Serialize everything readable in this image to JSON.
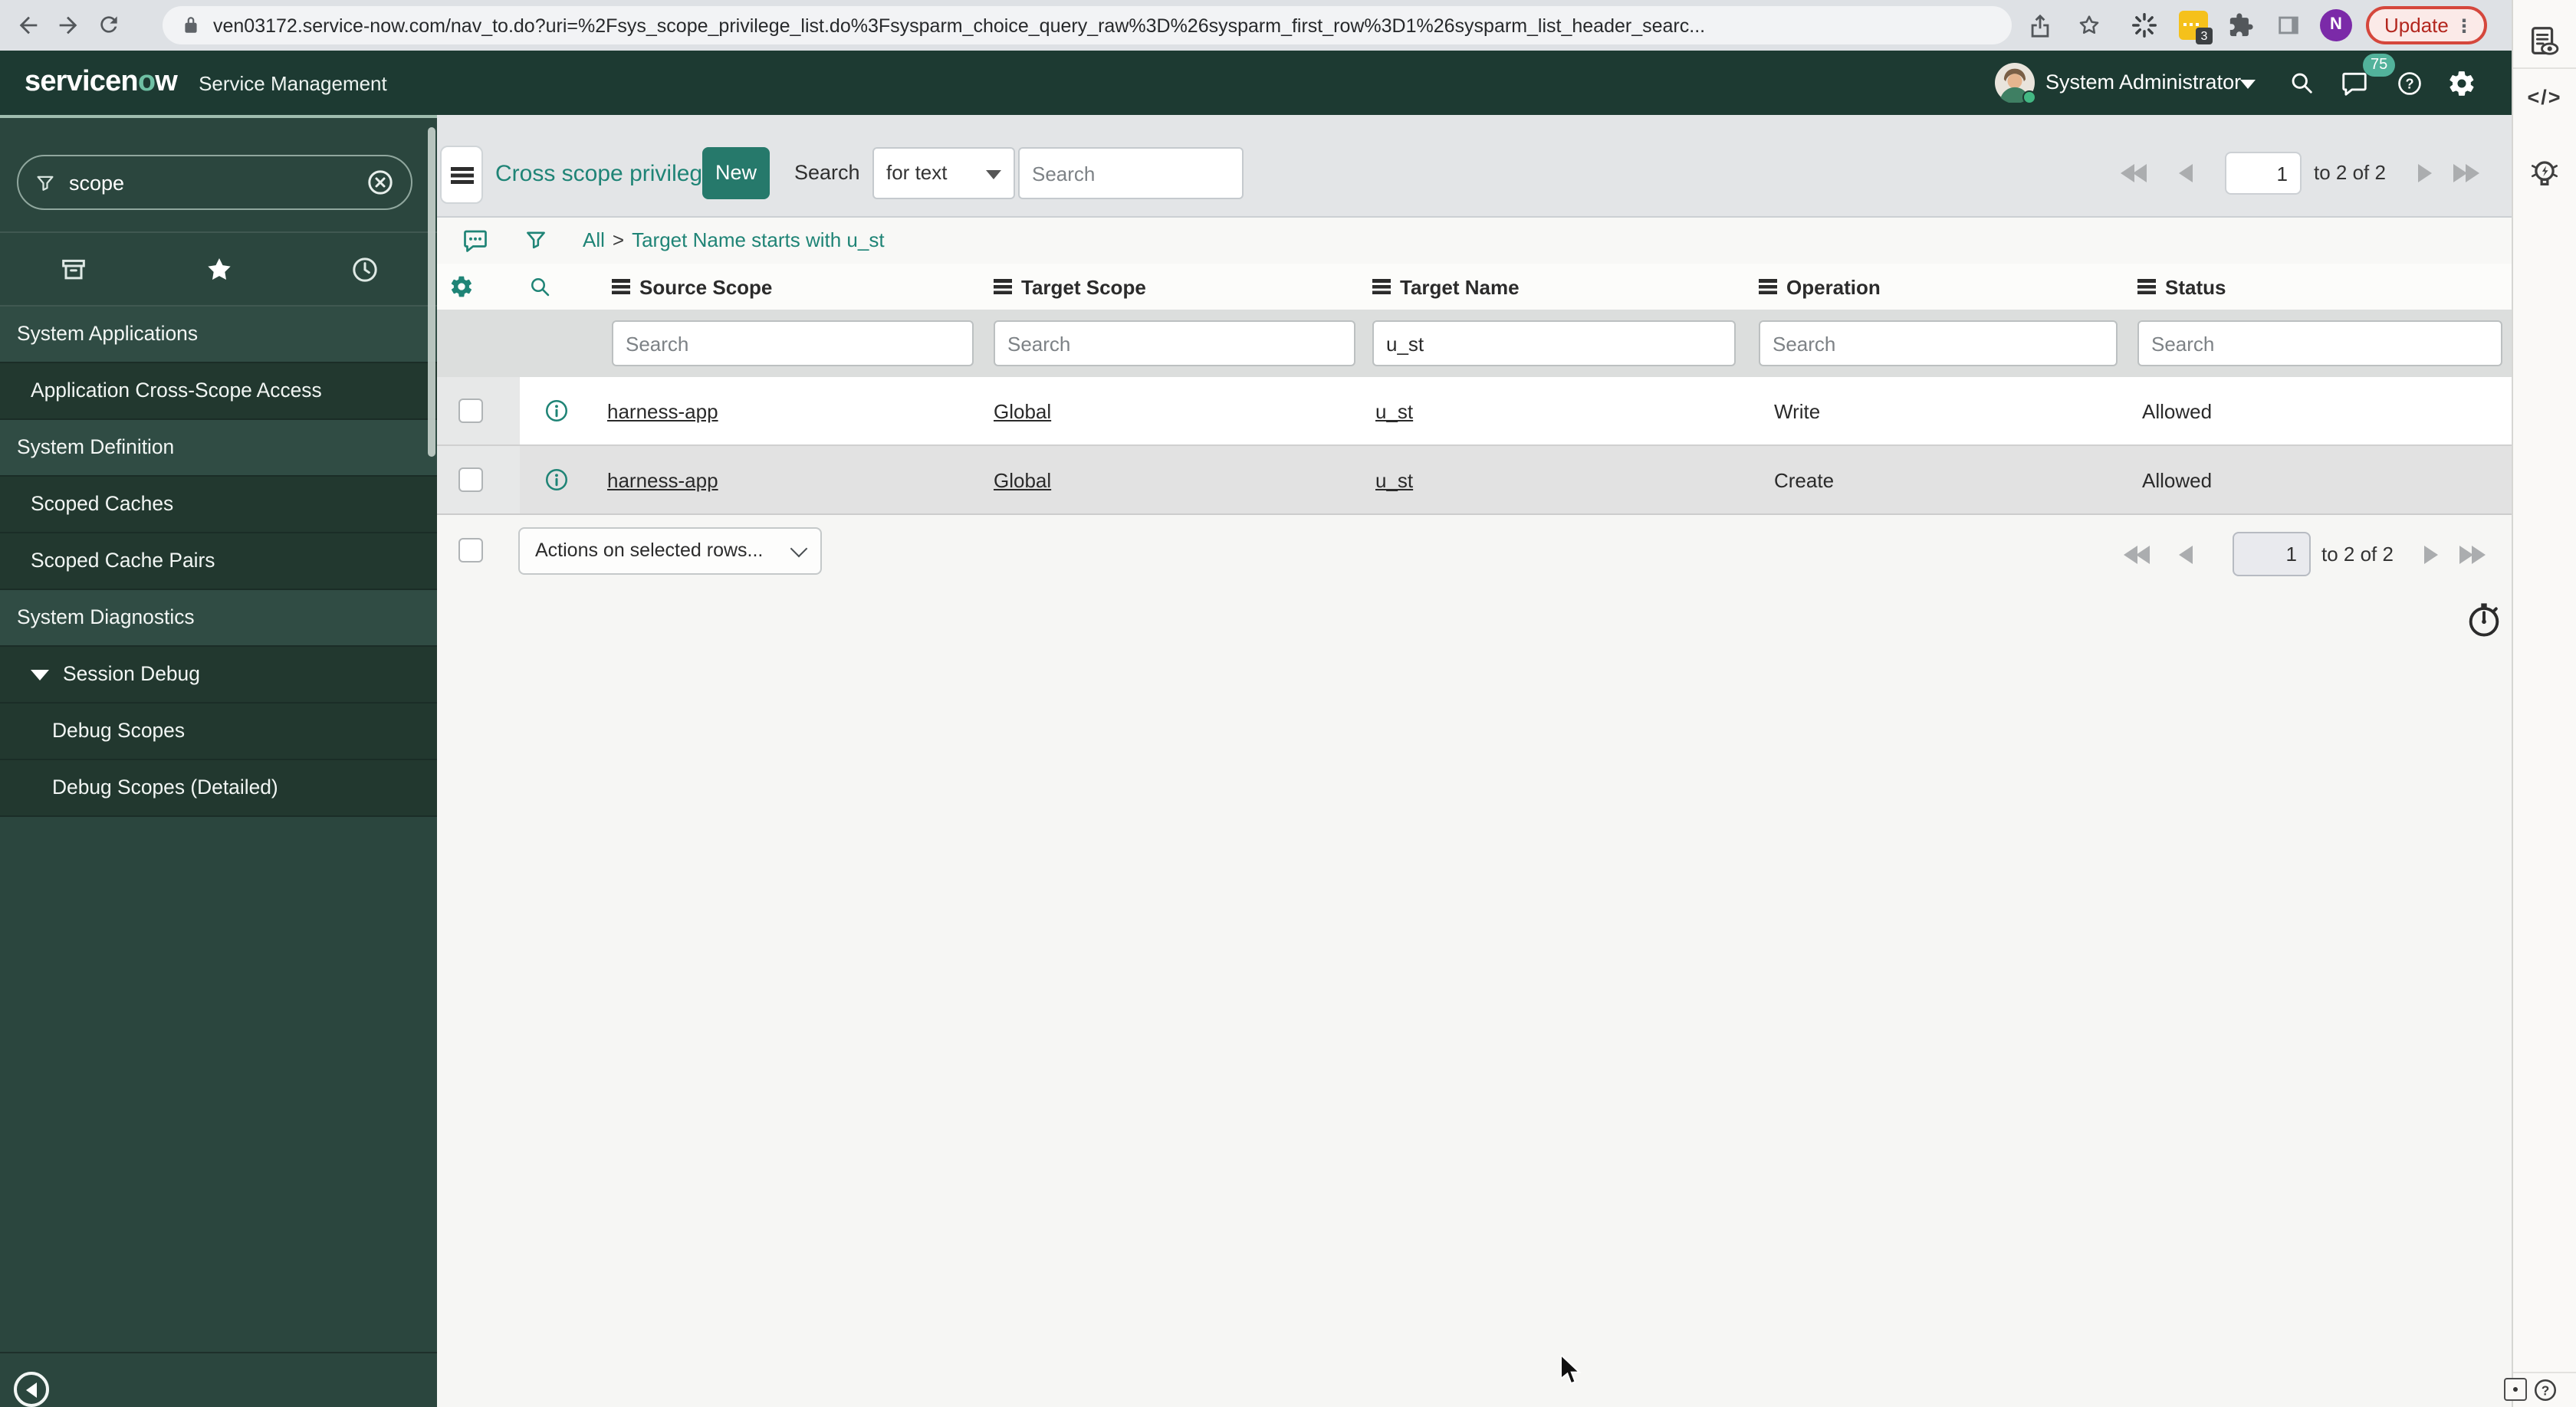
{
  "browser": {
    "url": "ven03172.service-now.com/nav_to.do?uri=%2Fsys_scope_privilege_list.do%3Fsysparm_choice_query_raw%3D%26sysparm_first_row%3D1%26sysparm_list_header_searc...",
    "update_label": "Update",
    "extension_badge": "3",
    "profile_initial": "N"
  },
  "icons": {
    "code": "</>",
    "more_vertical": "⋮",
    "breadcrumb_sep": ">"
  },
  "app_header": {
    "logo_prefix": "servicen",
    "logo_o": "o",
    "logo_suffix": "w",
    "product_name": "Service Management",
    "user_name": "System Administrator",
    "notification_count": "75"
  },
  "sidebar": {
    "filter_value": "scope",
    "items": [
      {
        "label": "System Applications"
      },
      {
        "label": "Application Cross-Scope Access"
      },
      {
        "label": "System Definition"
      },
      {
        "label": "Scoped Caches"
      },
      {
        "label": "Scoped Cache Pairs"
      },
      {
        "label": "System Diagnostics"
      },
      {
        "label": "Session Debug"
      },
      {
        "label": "Debug Scopes"
      },
      {
        "label": "Debug Scopes (Detailed)"
      }
    ]
  },
  "list": {
    "title": "Cross scope privileges",
    "new_button": "New",
    "search_label": "Search",
    "search_type": "for text",
    "search_placeholder": "Search",
    "breadcrumb_root": "All",
    "breadcrumb_filter": "Target Name starts with u_st",
    "columns": [
      {
        "label": "Source Scope",
        "filter_placeholder": "Search",
        "filter_value": ""
      },
      {
        "label": "Target Scope",
        "filter_placeholder": "Search",
        "filter_value": ""
      },
      {
        "label": "Target Name",
        "filter_placeholder": "Search",
        "filter_value": "u_st"
      },
      {
        "label": "Operation",
        "filter_placeholder": "Search",
        "filter_value": ""
      },
      {
        "label": "Status",
        "filter_placeholder": "Search",
        "filter_value": ""
      }
    ],
    "rows": [
      {
        "source_scope": "harness-app",
        "target_scope": "Global",
        "target_name": "u_st",
        "operation": "Write",
        "status": "Allowed"
      },
      {
        "source_scope": "harness-app",
        "target_scope": "Global",
        "target_name": "u_st",
        "operation": "Create",
        "status": "Allowed"
      }
    ],
    "actions_placeholder": "Actions on selected rows...",
    "pagination": {
      "current_page": "1",
      "range_text": "to 2 of 2"
    }
  },
  "colors": {
    "brand_teal": "#1f8476",
    "header_green": "#1d3a32",
    "notification_badge": "#52b29b",
    "update_red": "#b3261e",
    "new_button": "#26796b"
  }
}
